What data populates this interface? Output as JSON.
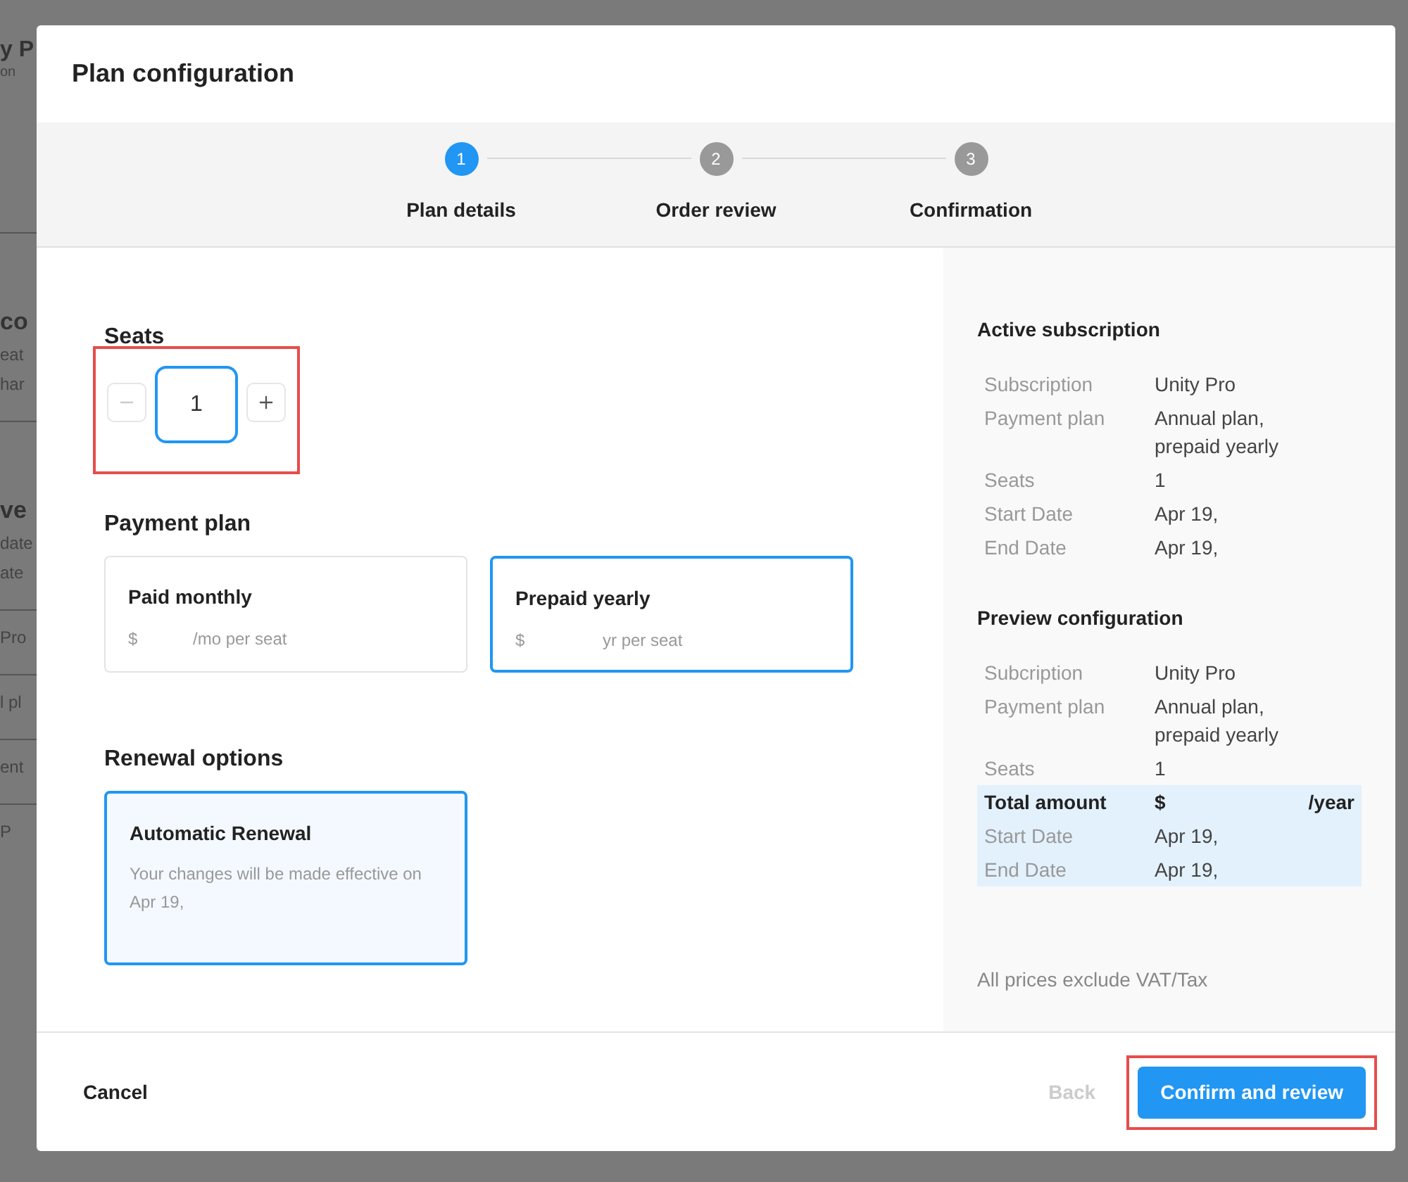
{
  "background_page": {
    "fragments": [
      {
        "text": "y P",
        "kind": "heading",
        "divider_after": false
      },
      {
        "text": "on",
        "kind": "small",
        "divider_after": true
      },
      {
        "text": "co",
        "kind": "subheading",
        "divider_after": false
      },
      {
        "text": "eat",
        "kind": "body",
        "divider_after": false
      },
      {
        "text": "har",
        "kind": "body",
        "divider_after": true
      },
      {
        "text": "ve",
        "kind": "subheading",
        "divider_after": false
      },
      {
        "text": "date",
        "kind": "body",
        "divider_after": false
      },
      {
        "text": "ate",
        "kind": "body",
        "divider_after": true
      },
      {
        "text": "Pro",
        "kind": "body",
        "divider_after": true
      },
      {
        "text": "l pl",
        "kind": "body",
        "divider_after": true
      },
      {
        "text": "ent",
        "kind": "body",
        "divider_after": true
      },
      {
        "text": "P",
        "kind": "body",
        "divider_after": false
      }
    ]
  },
  "dialog": {
    "title": "Plan configuration",
    "steps": [
      {
        "number": "1",
        "label": "Plan details",
        "selected": true
      },
      {
        "number": "2",
        "label": "Order review",
        "selected": false
      },
      {
        "number": "3",
        "label": "Confirmation",
        "selected": false
      }
    ],
    "seats": {
      "label": "Seats",
      "value": "1",
      "highlighted": true,
      "decrement_disabled": true
    },
    "payment_plan": {
      "label": "Payment plan",
      "options": [
        {
          "title": "Paid monthly",
          "price_prefix": "$",
          "price_suffix": "/mo per seat",
          "selected": false
        },
        {
          "title": "Prepaid yearly",
          "price_prefix": "$",
          "price_suffix": "yr per seat",
          "selected": true
        }
      ]
    },
    "renewal": {
      "label": "Renewal options",
      "options": [
        {
          "title": "Automatic Renewal",
          "description": "Your changes will be made effective on Apr 19,",
          "selected": true
        }
      ]
    },
    "summary": {
      "sections": [
        {
          "title": "Active subscription",
          "rows": [
            {
              "label": "Subscription",
              "value": "Unity Pro",
              "highlighted": false,
              "bold": false
            },
            {
              "label": "Payment plan",
              "value": "Annual plan, prepaid yearly",
              "highlighted": false,
              "bold": false
            },
            {
              "label": "Seats",
              "value": "1",
              "highlighted": false,
              "bold": false
            },
            {
              "label": "Start Date",
              "value": "Apr 19,",
              "highlighted": false,
              "bold": false
            },
            {
              "label": "End Date",
              "value": "Apr 19,",
              "highlighted": false,
              "bold": false
            }
          ]
        },
        {
          "title": "Preview configuration",
          "rows": [
            {
              "label": "Subcription",
              "value": "Unity Pro",
              "highlighted": false,
              "bold": false
            },
            {
              "label": "Payment plan",
              "value": "Annual plan, prepaid yearly",
              "highlighted": false,
              "bold": false
            },
            {
              "label": "Seats",
              "value": "1",
              "highlighted": false,
              "bold": false
            },
            {
              "label": "Total amount",
              "value": "$",
              "value_suffix": "/year",
              "highlighted": true,
              "bold": true
            },
            {
              "label": "Start Date",
              "value": "Apr 19,",
              "highlighted": true,
              "bold": false
            },
            {
              "label": "End Date",
              "value": "Apr 19,",
              "highlighted": true,
              "bold": false
            }
          ]
        }
      ],
      "note": "All prices exclude VAT/Tax"
    },
    "footer": {
      "cancel": "Cancel",
      "back": {
        "label": "Back",
        "disabled": true
      },
      "confirm": {
        "label": "Confirm and review",
        "highlighted": true
      }
    }
  }
}
